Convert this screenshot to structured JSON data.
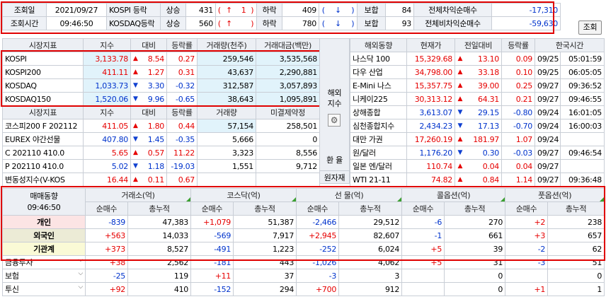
{
  "top": {
    "r1": [
      "조회일",
      "2021/09/27",
      "KOSPI 등락",
      "상승",
      "431",
      "(",
      "↑",
      "1",
      ")",
      "하락",
      "409",
      "(",
      "↓",
      ")",
      "보합",
      "84",
      "전체차익순매수",
      "-17,310"
    ],
    "r2": [
      "조회시간",
      "09:46:50",
      "KOSDAQ등락",
      "상승",
      "560",
      "(",
      "↑",
      "",
      ")",
      "하락",
      "780",
      "(",
      "↓",
      ")",
      "보합",
      "93",
      "전체비차익순매수",
      "-59,630"
    ],
    "btn": "조회"
  },
  "idx": {
    "head": [
      "시장지표",
      "지수",
      "대비",
      "등락률",
      "거래량(천주)",
      "거래대금(백만)"
    ],
    "rows": [
      [
        "KOSPI",
        "3,133.78",
        "▲",
        "8.54",
        "0.27",
        "259,546",
        "3,535,568"
      ],
      [
        "KOSPI200",
        "411.11",
        "▲",
        "1.27",
        "0.31",
        "43,637",
        "2,290,881"
      ],
      [
        "KOSDAQ",
        "1,033.73",
        "▼",
        "3.30",
        "-0.32",
        "312,587",
        "3,057,893"
      ],
      [
        "KOSDAQ150",
        "1,520.06",
        "▼",
        "9.96",
        "-0.65",
        "38,643",
        "1,095,891"
      ]
    ],
    "head2": [
      "시장지표",
      "지수",
      "대비",
      "등락률",
      "거래량",
      "미결제약정"
    ],
    "rows2": [
      [
        "코스피200 F 202112",
        "411.05",
        "▲",
        "1.80",
        "0.44",
        "57,154",
        "258,501"
      ],
      [
        "EUREX 야간선물",
        "407.80",
        "▼",
        "1.45",
        "-0.35",
        "5,666",
        "0"
      ],
      [
        "C 202110 410.0",
        "5.65",
        "▲",
        "0.57",
        "11.22",
        "3,323",
        "8,556"
      ],
      [
        "P 202110 410.0",
        "5.02",
        "▼",
        "1.18",
        "-19.03",
        "1,551",
        "9,712"
      ],
      [
        "변동성지수(V-KOS",
        "16.44",
        "▲",
        "0.11",
        "0.67",
        "",
        ""
      ]
    ]
  },
  "side": {
    "overseas": "해외지수",
    "gear": "⚙",
    "fx": "환 율",
    "raw": "원자재"
  },
  "world": {
    "head": [
      "해외동향",
      "현재가",
      "전일대비",
      "등락률",
      "한국시간"
    ],
    "rows": [
      [
        "나스닥 100",
        "15,329.68",
        "▲",
        "13.10",
        "0.09",
        "09/25",
        "05:01:59"
      ],
      [
        "다우 산업",
        "34,798.00",
        "▲",
        "33.18",
        "0.10",
        "09/25",
        "06:05:05"
      ],
      [
        "E-Mini 나스",
        "15,357.75",
        "▲",
        "39.00",
        "0.25",
        "09/27",
        "09:36:52"
      ],
      [
        "니케이225",
        "30,313.12",
        "▲",
        "64.31",
        "0.21",
        "09/27",
        "09:46:55"
      ],
      [
        "상해종합",
        "3,613.07",
        "▼",
        "29.15",
        "-0.80",
        "09/24",
        "16:01:05"
      ],
      [
        "심천종합지수",
        "2,434.23",
        "▼",
        "17.13",
        "-0.70",
        "09/24",
        "16:00:03"
      ],
      [
        "대만 가권",
        "17,260.19",
        "▲",
        "181.97",
        "1.07",
        "09/24",
        ""
      ],
      [
        "원/달러",
        "1,176.20",
        "▼",
        "0.30",
        "-0.03",
        "09/27",
        "09:46:54"
      ],
      [
        "일본 엔/달러",
        "110.74",
        "▲",
        "0.04",
        "0.04",
        "09/27",
        ""
      ],
      [
        "WTI 21-11",
        "74.82",
        "▲",
        "0.84",
        "1.14",
        "09/27",
        "09:36:48"
      ]
    ]
  },
  "inv": {
    "title": "매매동향",
    "time": "09:46:50",
    "groups": [
      "거래소(억)",
      "코스닥(억)",
      "선 물(억)",
      "콜옵션(억)",
      "풋옵션(억)"
    ],
    "sub": [
      "순매수",
      "총누적"
    ],
    "rows": [
      [
        "개인",
        "-839",
        "47,383",
        "+1,079",
        "51,387",
        "-2,466",
        "29,512",
        "-6",
        "270",
        "+2",
        "238"
      ],
      [
        "외국인",
        "+563",
        "14,033",
        "-569",
        "7,917",
        "+2,945",
        "82,607",
        "-1",
        "661",
        "+3",
        "657"
      ],
      [
        "기관계",
        "+373",
        "8,527",
        "-491",
        "1,223",
        "-252",
        "6,024",
        "+5",
        "39",
        "-2",
        "62"
      ],
      [
        "금융투자",
        "+38",
        "2,562",
        "-181",
        "443",
        "-1,026",
        "4,062",
        "+5",
        "31",
        "-3",
        "51"
      ],
      [
        "보험",
        "-25",
        "119",
        "+11",
        "37",
        "-3",
        "3",
        "",
        "0",
        "",
        "0"
      ],
      [
        "투신",
        "+92",
        "410",
        "-152",
        "294",
        "+700",
        "912",
        "",
        "0",
        "+1",
        "1"
      ]
    ]
  },
  "colors": {
    "up": "#e60000",
    "down": "#0033cc",
    "box": "#e00000"
  }
}
